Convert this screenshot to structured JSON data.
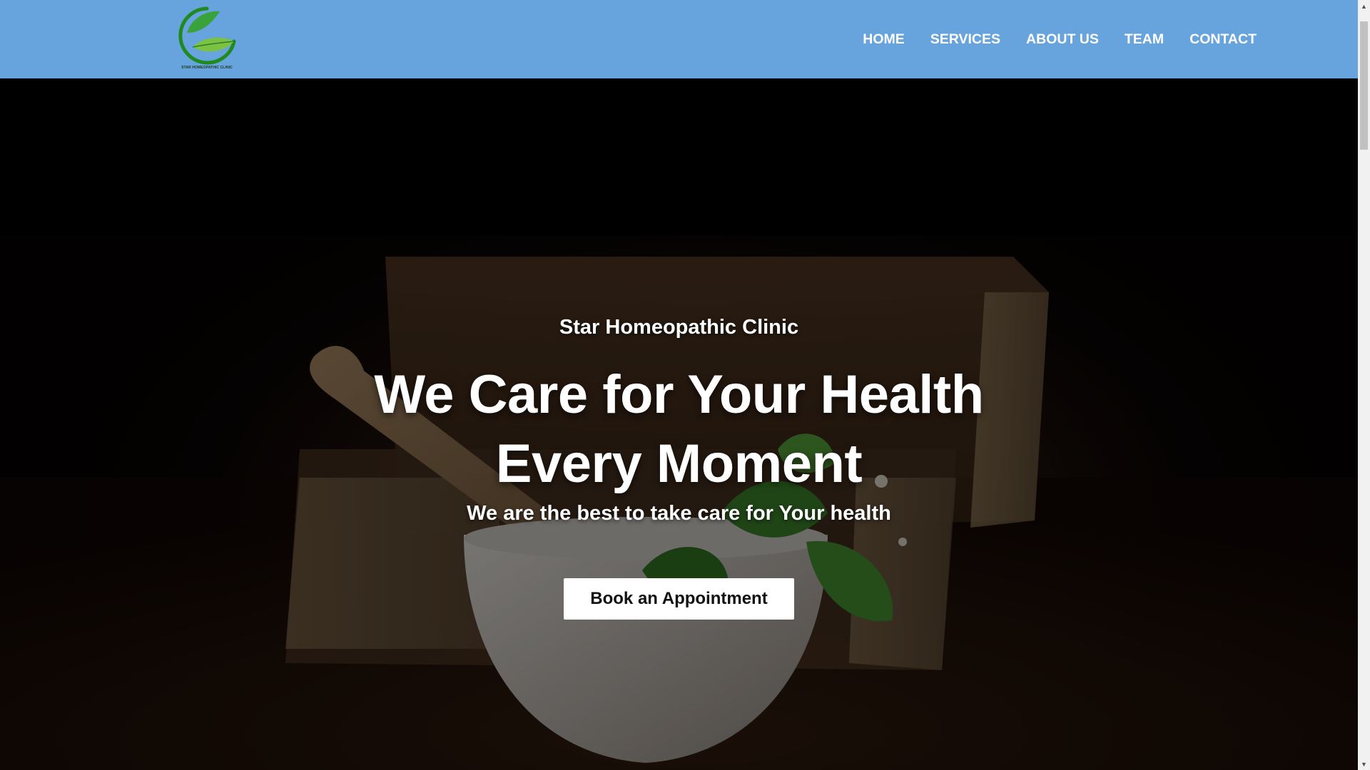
{
  "header": {
    "logo": {
      "icon": "leaf-logo-icon",
      "caption": "STAR HOMEOPATHIC CLINIC"
    },
    "nav": [
      {
        "label": "HOME"
      },
      {
        "label": "SERVICES"
      },
      {
        "label": "ABOUT US"
      },
      {
        "label": "TEAM"
      },
      {
        "label": "CONTACT"
      }
    ]
  },
  "hero": {
    "kicker": "Star Homeopathic Clinic",
    "title_line1": "We Care for Your Health",
    "title_line2": "Every Moment",
    "subtitle": "We are the best to take care for Your health",
    "cta_label": "Book an Appointment",
    "background_image": "books-mortar-pestle-herbs"
  },
  "colors": {
    "header_bg": "#67a3dc",
    "logo_green": "#2e9a2e",
    "cta_bg": "#ffffff",
    "hero_text": "#ffffff"
  },
  "scrollbar": {
    "up_icon": "chevron-up-icon",
    "down_icon": "chevron-down-icon"
  }
}
